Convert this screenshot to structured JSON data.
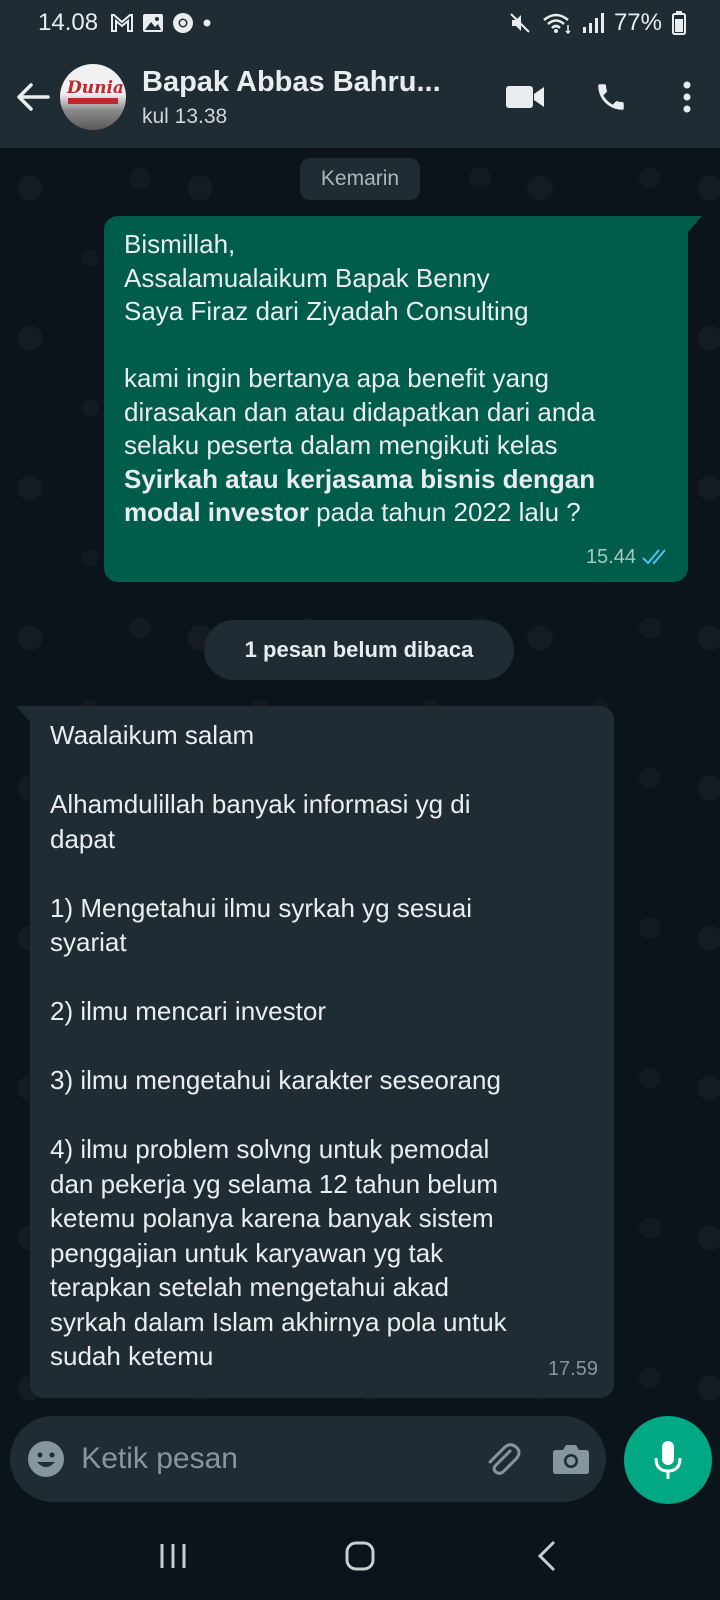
{
  "status_bar": {
    "time": "14.08",
    "battery": "77%",
    "left_icons": [
      "gmail-icon",
      "gallery-icon",
      "chrome-icon",
      "dot-icon"
    ],
    "right_icons": [
      "mute-icon",
      "wifi-icon",
      "signal-icon",
      "battery-icon"
    ]
  },
  "header": {
    "name": "Bapak Abbas Bahru...",
    "last_seen": "kul 13.38",
    "avatar_logo": "Dunia"
  },
  "chat": {
    "date_divider": "Kemarin",
    "outgoing": {
      "line1": "Bismillah,",
      "line2": "Assalamualaikum Bapak Benny",
      "line3": "Saya Firaz dari Ziyadah Consulting",
      "line4": "kami ingin bertanya apa benefit yang",
      "line5": "dirasakan dan atau didapatkan dari anda",
      "line6": "selaku peserta dalam mengikuti kelas",
      "line7_bold": "Syirkah atau kerjasama bisnis dengan",
      "line8_bold": "modal investor",
      "line8_rest": " pada tahun 2022 lalu ?",
      "time": "15.44",
      "status": "read"
    },
    "unread_divider": "1 pesan belum dibaca",
    "incoming": {
      "lines": [
        "Waalaikum salam",
        "",
        "Alhamdulillah banyak informasi yg di",
        "dapat",
        "",
        "1) Mengetahui ilmu syrkah yg sesuai",
        "syariat",
        "",
        "2) ilmu mencari investor",
        "",
        "3) ilmu mengetahui karakter seseorang",
        "",
        "4) ilmu problem solvng untuk pemodal",
        "dan pekerja yg selama 12 tahun belum",
        "ketemu polanya karena banyak sistem",
        "penggajian untuk karyawan yg tak",
        "terapkan setelah mengetahui akad",
        "syrkah dalam Islam akhirnya pola untuk",
        "sudah ketemu"
      ],
      "time": "17.59"
    }
  },
  "input": {
    "placeholder": "Ketik pesan",
    "value": ""
  },
  "colors": {
    "header_bg": "#1f2c34",
    "chat_bg": "#0b141a",
    "outgoing_bubble": "#005c4b",
    "incoming_bubble": "#202c33",
    "accent": "#00a884",
    "read_tick": "#53bdeb"
  }
}
